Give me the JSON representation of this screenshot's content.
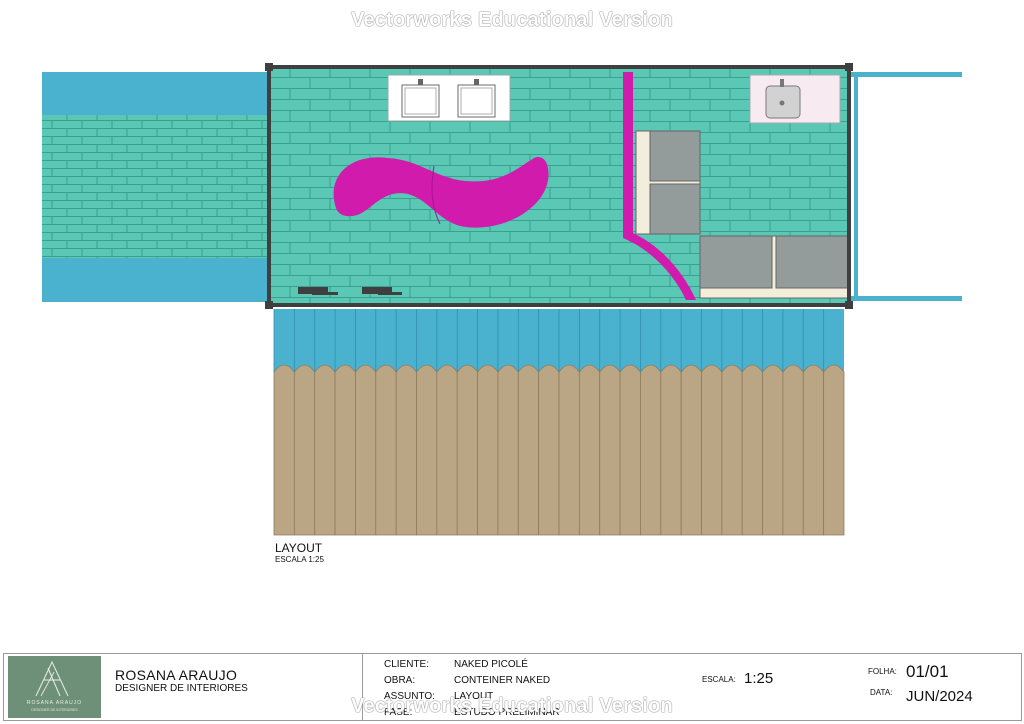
{
  "watermark": "Vectorworks Educational Version",
  "drawing": {
    "title": "LAYOUT",
    "scale_note": "ESCALA 1:25"
  },
  "colors": {
    "tile": "#5ac8b4",
    "tile_joint": "#3aa08f",
    "water": "#4ab2cf",
    "fence": "#baa584",
    "magenta": "#d11bad",
    "wall": "#3f3f3f",
    "counter": "#939b9b",
    "logo_bg": "#6e9078"
  },
  "title_block": {
    "logo": {
      "name": "ROSANA ARAUJO",
      "tagline": "DESIGNER DE INTERIORES"
    },
    "designer": {
      "name": "ROSANA ARAUJO",
      "role": "DESIGNER DE INTERIORES"
    },
    "fields": [
      {
        "label": "CLIENTE:",
        "value": "NAKED PICOLÉ"
      },
      {
        "label": "OBRA:",
        "value": "CONTEINER NAKED"
      },
      {
        "label": "ASSUNTO:",
        "value": "LAYOUT"
      },
      {
        "label": "FASE:",
        "value": "ESTUDO PRELIMINAR"
      }
    ],
    "escala": {
      "label": "ESCALA:",
      "value": "1:25"
    },
    "folha": {
      "label": "FOLHA:",
      "value": "01/01"
    },
    "data": {
      "label": "DATA:",
      "value": "JUN/2024"
    }
  }
}
